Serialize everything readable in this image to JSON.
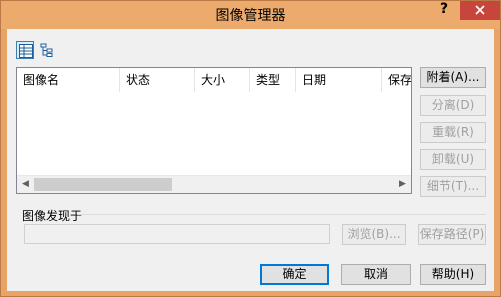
{
  "window": {
    "title": "图像管理器",
    "help_symbol": "?",
    "close_symbol": "x"
  },
  "toolbar": {
    "view_buttons": [
      {
        "icon": "details-view-icon",
        "active": true
      },
      {
        "icon": "tree-view-icon",
        "active": false
      }
    ]
  },
  "list": {
    "columns": [
      "图像名",
      "状态",
      "大小",
      "类型",
      "日期",
      "保存"
    ]
  },
  "side_buttons": {
    "attach": "附着(A)...",
    "detach": "分离(D)",
    "reload": "重载(R)",
    "unload": "卸载(U)",
    "details": "细节(T)..."
  },
  "found_in": {
    "label": "图像发现于",
    "path_value": "",
    "browse": "浏览(B)...",
    "save_path": "保存路径(P)"
  },
  "footer": {
    "ok": "确定",
    "cancel": "取消",
    "help": "帮助(H)"
  }
}
